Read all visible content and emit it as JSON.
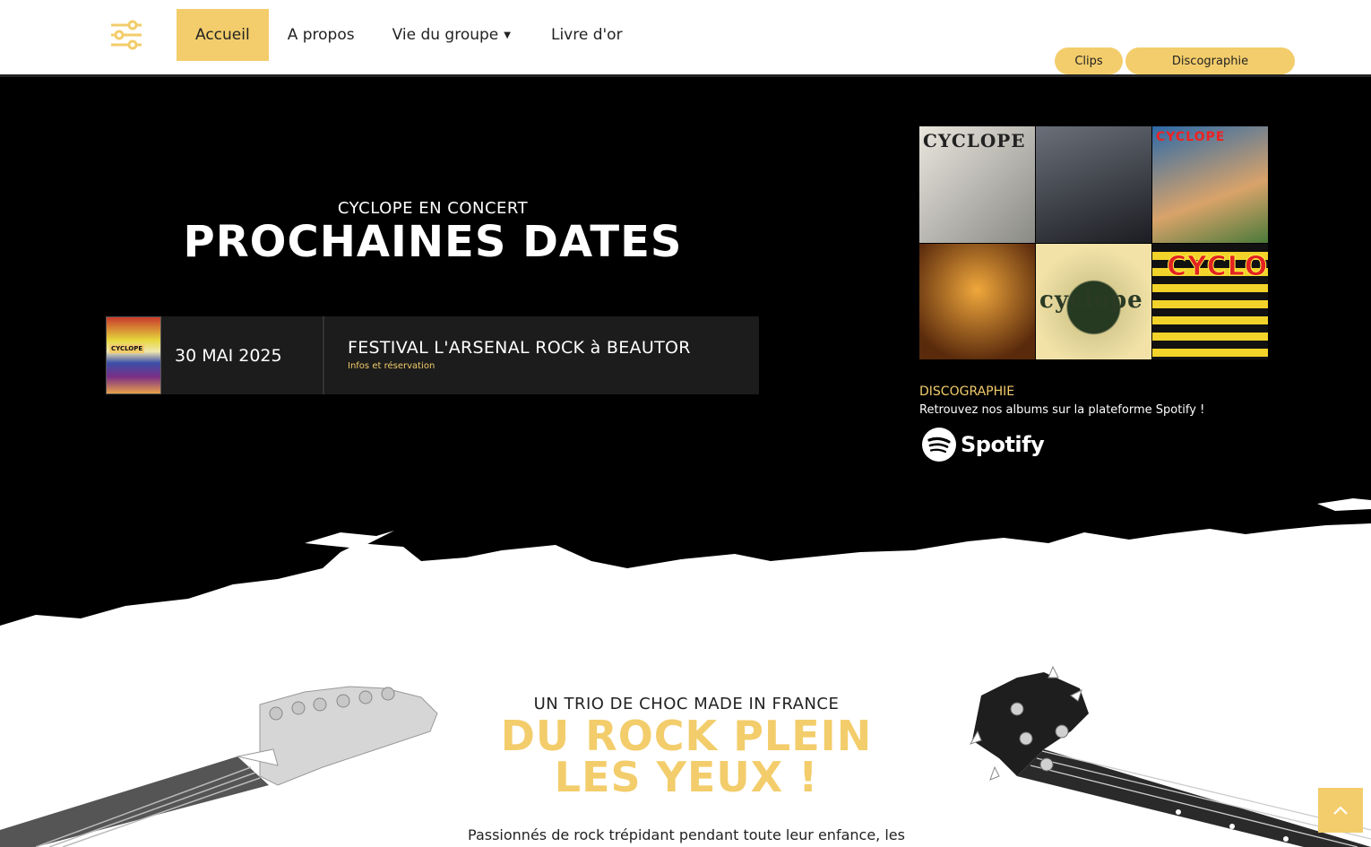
{
  "nav": {
    "menu_icon": "sliders-icon",
    "items": [
      {
        "label": "Accueil",
        "active": true
      },
      {
        "label": "A propos",
        "active": false
      },
      {
        "label": "Vie du groupe",
        "active": false,
        "has_dropdown": true
      },
      {
        "label": "Livre d'or",
        "active": false
      }
    ],
    "pills": {
      "clips": "Clips",
      "discographie": "Discographie"
    }
  },
  "hero": {
    "kicker": "CYCLOPE EN CONCERT",
    "title": "PROCHAINES DATES",
    "event": {
      "thumb_caption": "CYCLOPE",
      "date": "30 MAI 2025",
      "name": "FESTIVAL L'ARSENAL ROCK à BEAUTOR",
      "link": "Infos et réservation"
    },
    "albums": [
      "CYCLOPE",
      "",
      "CYCLOPE",
      "",
      "cyclope",
      "CYCLOPE"
    ],
    "discography": {
      "label": "DISCOGRAPHIE",
      "text": "Retrouvez nos albums sur la plateforme Spotify !",
      "spotify": "Spotify"
    }
  },
  "lower": {
    "kicker": "UN TRIO DE CHOC MADE IN FRANCE",
    "title": "DU ROCK PLEIN LES YEUX !",
    "lede": "Passionnés de rock trépidant pendant toute leur enfance, les"
  },
  "colors": {
    "accent": "#f3cd6b",
    "dark": "#000000",
    "card": "#1c1c1c"
  },
  "to_top_icon": "chevron-up-icon"
}
